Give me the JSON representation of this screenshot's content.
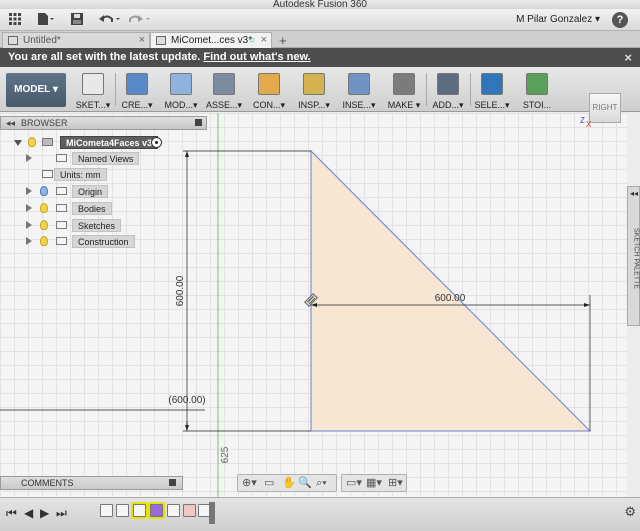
{
  "app": {
    "title": "Autodesk Fusion 360"
  },
  "quick_access": {
    "grid_icon": "grid-menu-icon",
    "file_icon": "file-icon",
    "save_icon": "save-icon",
    "undo_icon": "undo-icon",
    "redo_icon": "redo-icon",
    "user": "M Pilar Gonzalez ▾",
    "help_label": "?"
  },
  "tabs": [
    {
      "label": "Untitled*",
      "active": false
    },
    {
      "label": "MiComet...ces v3*",
      "active": true
    }
  ],
  "tab_add": "+",
  "banner": {
    "message": "You are all set with the latest update.",
    "link": "Find out what's new.",
    "close": "×"
  },
  "ribbon": {
    "workspace": "MODEL ▾",
    "buttons": [
      {
        "label": "SKET...▾",
        "icon": "sketch-icon",
        "color": "#e8e8e8"
      },
      {
        "label": "CRE...▾",
        "icon": "create-icon",
        "color": "#5a89c8"
      },
      {
        "label": "MOD...▾",
        "icon": "modify-icon",
        "color": "#8fb2df"
      },
      {
        "label": "ASSE...▾",
        "icon": "assemble-icon",
        "color": "#7a8c9e"
      },
      {
        "label": "CON...▾",
        "icon": "construct-icon",
        "color": "#e3a94a"
      },
      {
        "label": "INSP...▾",
        "icon": "inspect-icon",
        "color": "#d3b24f"
      },
      {
        "label": "INSE...▾",
        "icon": "insert-icon",
        "color": "#6f94c4"
      },
      {
        "label": "MAKE ▾",
        "icon": "make-icon",
        "color": "#7b7b7b"
      },
      {
        "label": "ADD...▾",
        "icon": "addins-icon",
        "color": "#5a6c7e"
      },
      {
        "label": "SELE...▾",
        "icon": "select-icon",
        "color": "#2f77b8"
      },
      {
        "label": "STOI...",
        "icon": "stop-sketch-icon",
        "color": "#5aa05a"
      }
    ]
  },
  "viewcube": {
    "face": "RIGHT",
    "axis_z": "Z",
    "axis_x": "X"
  },
  "browser": {
    "title": "BROWSER",
    "root": "MiCometa4Faces v3",
    "items": [
      {
        "label": "Named Views",
        "bulb": false,
        "folder": true
      },
      {
        "label": "Units: mm",
        "bulb": false,
        "folder": false
      },
      {
        "label": "Origin",
        "bulb": "blue",
        "folder": true
      },
      {
        "label": "Bodies",
        "bulb": "yellow",
        "folder": true
      },
      {
        "label": "Sketches",
        "bulb": "yellow",
        "folder": true
      },
      {
        "label": "Construction",
        "bulb": "yellow",
        "folder": true
      }
    ]
  },
  "sketch": {
    "dim_vertical": "600.00",
    "dim_horizontal": "600.00",
    "ref_dim": "(600.00)",
    "ruler_tick": "625",
    "fill_color": "#f6e6d2",
    "line_color": "#6a7fd9"
  },
  "sketch_palette": {
    "label": "SKETCH PALETTE",
    "collapse": "◂◂"
  },
  "comments": {
    "label": "COMMENTS"
  },
  "timeline": {
    "controls": [
      "⏮",
      "◀",
      "▶",
      "⏭"
    ],
    "gear": "⚙"
  }
}
